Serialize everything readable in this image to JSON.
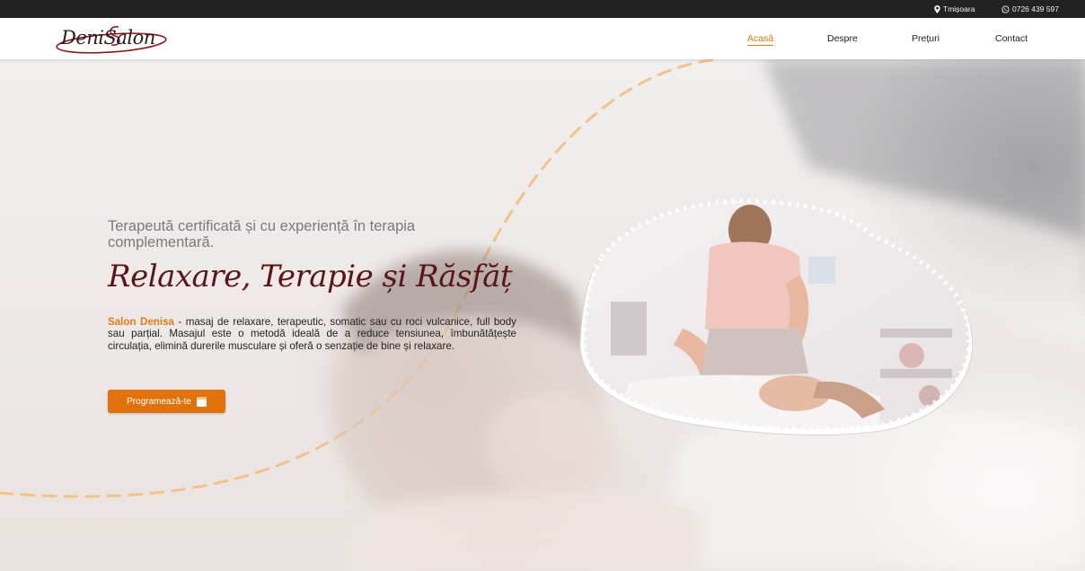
{
  "topbar": {
    "location": "Tmișoara",
    "phone": "0726 439 597",
    "location_icon": "map-pin-icon",
    "phone_icon": "whatsapp-icon"
  },
  "header": {
    "logo_text": "DeniSalon",
    "nav": {
      "home": "Acasă",
      "about": "Despre",
      "prices": "Prețuri",
      "contact": "Contact"
    }
  },
  "hero": {
    "subtitle": "Terapeută certificată și cu experiență în terapia complementară.",
    "headline": "Relaxare, Terapie și Răsfăț",
    "desc_brand": "Salon Denisa",
    "desc_text": " - masaj de relaxare, terapeutic, somatic sau cu roci vulcanice, full body sau parțial. Masajul este o metodă ideală de a reduce tensiunea, îmbunătățește circulația, elimină durerile musculare și oferă o senzație de bine și relaxare.",
    "cta_label": "Programează-te",
    "cta_icon": "calendar-icon"
  },
  "colors": {
    "accent": "#e07a14",
    "headline": "#5b1417",
    "topbar": "#222222"
  }
}
